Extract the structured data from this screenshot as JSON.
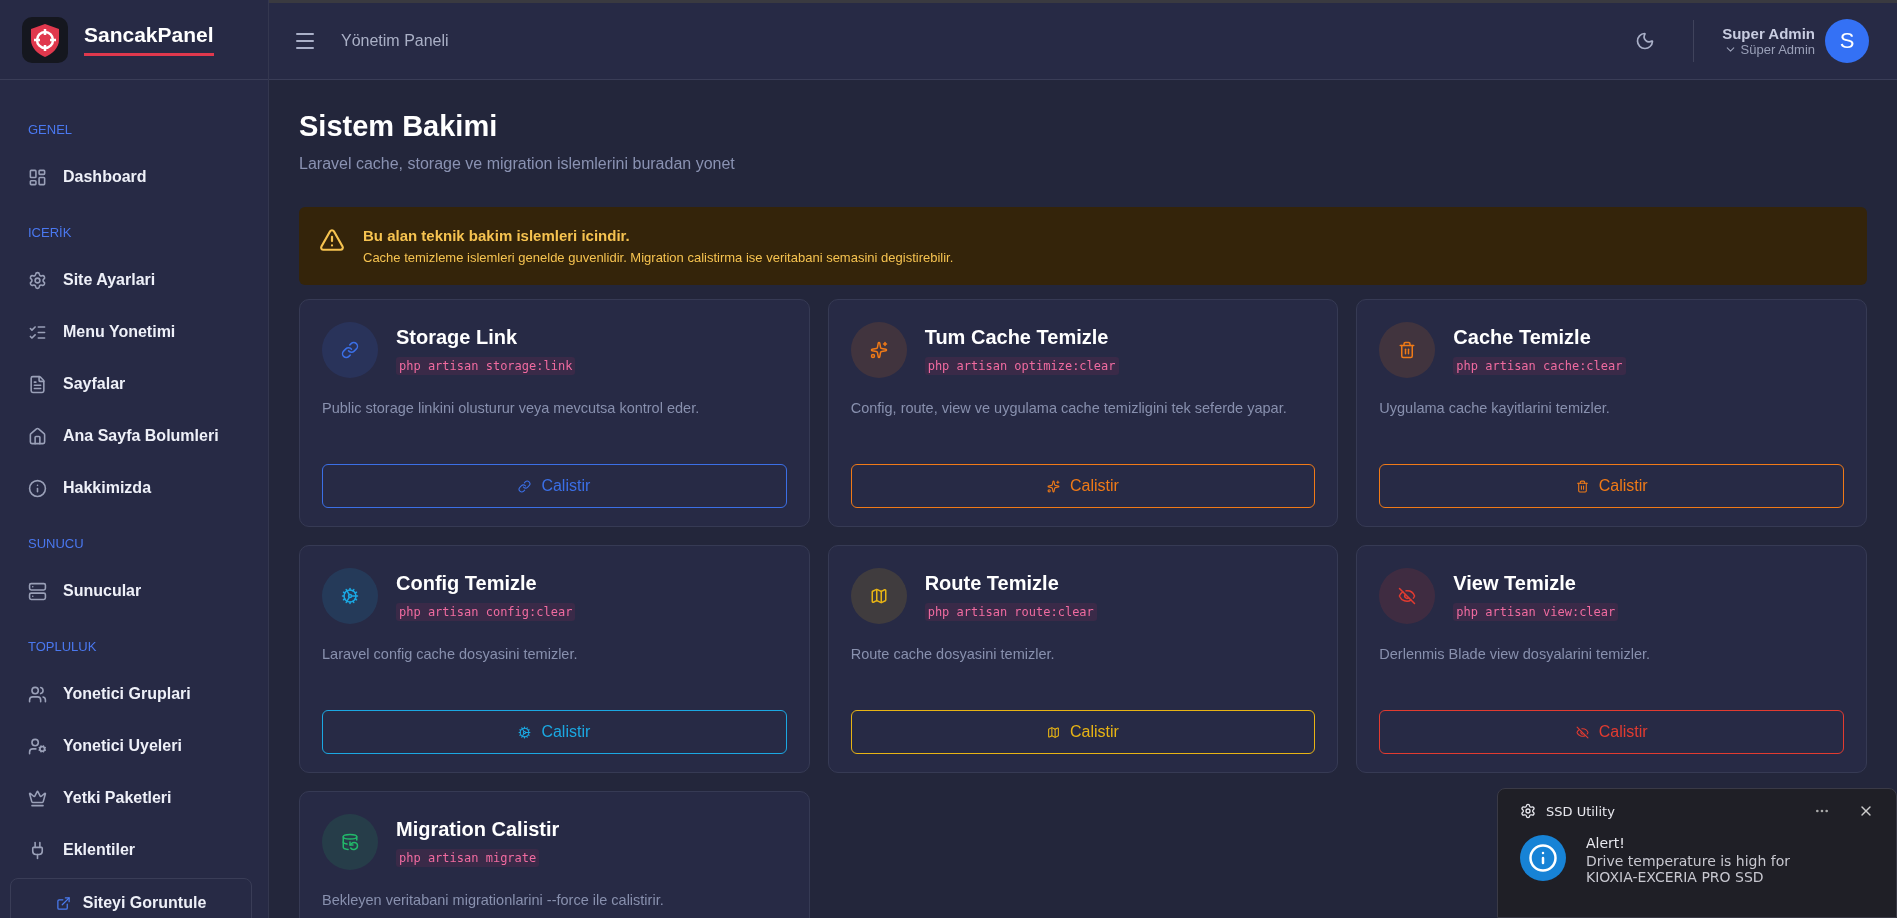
{
  "brand": {
    "name": "SancakPanel"
  },
  "header": {
    "title": "Yönetim Paneli",
    "user": {
      "name": "Super Admin",
      "role": "Süper Admin",
      "initial": "S"
    }
  },
  "sidebar": {
    "sections": [
      {
        "label": "GENEL",
        "items": [
          {
            "label": "Dashboard"
          }
        ]
      },
      {
        "label": "ICERİK",
        "items": [
          {
            "label": "Site Ayarlari"
          },
          {
            "label": "Menu Yonetimi"
          },
          {
            "label": "Sayfalar"
          },
          {
            "label": "Ana Sayfa Bolumleri"
          },
          {
            "label": "Hakkimizda"
          }
        ]
      },
      {
        "label": "SUNUCU",
        "items": [
          {
            "label": "Sunucular"
          }
        ]
      },
      {
        "label": "TOPLULUK",
        "items": [
          {
            "label": "Yonetici Gruplari"
          },
          {
            "label": "Yonetici Uyeleri"
          },
          {
            "label": "Yetki Paketleri"
          },
          {
            "label": "Eklentiler"
          }
        ]
      }
    ],
    "footer_link": "Siteyi Goruntule"
  },
  "page": {
    "title": "Sistem Bakimi",
    "subtitle": "Laravel cache, storage ve migration islemlerini buradan yonet"
  },
  "alert": {
    "title": "Bu alan teknik bakim islemleri icindir.",
    "text": "Cache temizleme islemleri genelde guvenlidir. Migration calistirma ise veritabani semasini degistirebilir."
  },
  "cards": [
    {
      "color": "#3b6fe6",
      "title": "Storage Link",
      "command": "php artisan storage:link",
      "description": "Public storage linkini olusturur veya mevcutsa kontrol eder.",
      "button": "Calistir"
    },
    {
      "color": "#f07a17",
      "title": "Tum Cache Temizle",
      "command": "php artisan optimize:clear",
      "description": "Config, route, view ve uygulama cache temizligini tek seferde yapar.",
      "button": "Calistir"
    },
    {
      "color": "#f07a17",
      "title": "Cache Temizle",
      "command": "php artisan cache:clear",
      "description": "Uygulama cache kayitlarini temizler.",
      "button": "Calistir"
    },
    {
      "color": "#1ba8e2",
      "title": "Config Temizle",
      "command": "php artisan config:clear",
      "description": "Laravel config cache dosyasini temizler.",
      "button": "Calistir"
    },
    {
      "color": "#e8b414",
      "title": "Route Temizle",
      "command": "php artisan route:clear",
      "description": "Route cache dosyasini temizler.",
      "button": "Calistir"
    },
    {
      "color": "#e23b30",
      "title": "View Temizle",
      "command": "php artisan view:clear",
      "description": "Derlenmis Blade view dosyalarini temizler.",
      "button": "Calistir"
    },
    {
      "color": "#22b86a",
      "title": "Migration Calistir",
      "command": "php artisan migrate",
      "description": "Bekleyen veritabani migrationlarini --force ile calistirir."
    }
  ],
  "toast": {
    "app": "SSD Utility",
    "title": "Alert!",
    "text": "Drive temperature is high for KIOXIA-EXCERIA PRO SSD"
  }
}
